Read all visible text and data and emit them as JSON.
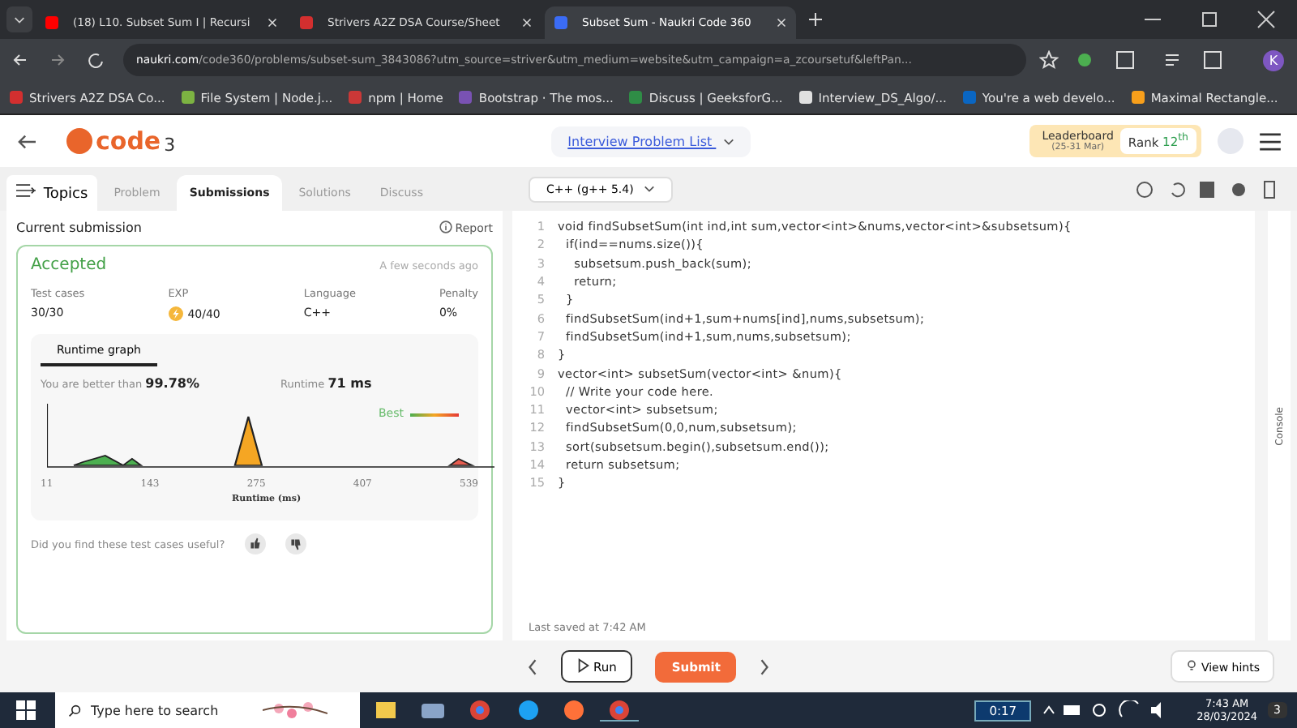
{
  "browser": {
    "tabs": [
      {
        "title": "(18) L10. Subset Sum I | Recursi",
        "selected": false
      },
      {
        "title": "Strivers A2Z DSA Course/Sheet",
        "selected": false
      },
      {
        "title": "Subset Sum - Naukri Code 360",
        "selected": true
      }
    ],
    "address": {
      "host": "naukri.com",
      "path": "/code360/problems/subset-sum_3843086?utm_source=striver&utm_medium=website&utm_campaign=a_zcoursetuf&leftPan..."
    },
    "profile": "K",
    "bookmarks": [
      "Strivers A2Z DSA Co...",
      "File System | Node.j...",
      "npm | Home",
      "Bootstrap · The mos...",
      "Discuss | GeeksforG...",
      "Interview_DS_Algo/...",
      "You're a web develo...",
      "Maximal Rectangle..."
    ]
  },
  "header": {
    "logo_text": "code",
    "logo_sup": "3",
    "problem_list": "Interview Problem List",
    "leaderboard": "Leaderboard",
    "leaderboard_dates": "(25-31 Mar)",
    "rank_label": "Rank",
    "rank_value": "12",
    "rank_suffix": "th"
  },
  "left_tabs": [
    {
      "label": "Problem",
      "selected": false
    },
    {
      "label": "Submissions",
      "selected": true
    },
    {
      "label": "Solutions",
      "selected": false
    },
    {
      "label": "Discuss",
      "selected": false
    }
  ],
  "topics_label": "Topics",
  "language_select": "C++ (g++ 5.4)",
  "submission": {
    "heading": "Current submission",
    "report": "Report",
    "status": "Accepted",
    "time": "A few seconds ago",
    "stats": [
      {
        "label": "Test cases",
        "value": "30/30",
        "kind": "plain"
      },
      {
        "label": "EXP",
        "value": "40/40",
        "kind": "exp"
      },
      {
        "label": "Language",
        "value": "C++",
        "kind": "plain"
      },
      {
        "label": "Penalty",
        "value": "0%",
        "kind": "plain"
      }
    ],
    "graph_tab": "Runtime graph",
    "better_label": "You are better than",
    "better_value": "99.78%",
    "runtime_label": "Runtime",
    "runtime_value": "71 ms",
    "best_label": "Best",
    "x_ticks": [
      "11",
      "143",
      "275",
      "407",
      "539"
    ],
    "x_label": "Runtime (ms)",
    "feedback": "Did you find these test cases useful?"
  },
  "line_numbers": [
    "1",
    "2",
    "3",
    "4",
    "5",
    "6",
    "7",
    "8",
    "9",
    "10",
    "11",
    "12",
    "13",
    "14",
    "15"
  ],
  "code_lines": [
    "void findSubsetSum(int ind,int sum,vector<int>&nums,vector<int>&subsetsum){",
    "  if(ind==nums.size()){",
    "    subsetsum.push_back(sum);",
    "    return;",
    "  }",
    "  findSubsetSum(ind+1,sum+nums[ind],nums,subsetsum);",
    "  findSubsetSum(ind+1,sum,nums,subsetsum);",
    "}",
    "vector<int> subsetSum(vector<int> &num){",
    "  // Write your code here.",
    "  vector<int> subsetsum;",
    "  findSubsetSum(0,0,num,subsetsum);",
    "  sort(subsetsum.begin(),subsetsum.end());",
    "  return subsetsum;",
    "}"
  ],
  "console_label": "Console",
  "last_saved": "Last saved at 7:42 AM",
  "run_label": "Run",
  "submit_label": "Submit",
  "hints_label": "View hints",
  "taskbar": {
    "search_placeholder": "Type here to search",
    "battery": "0:17",
    "time": "7:43 AM",
    "date": "28/03/2024",
    "notifications": "3"
  }
}
